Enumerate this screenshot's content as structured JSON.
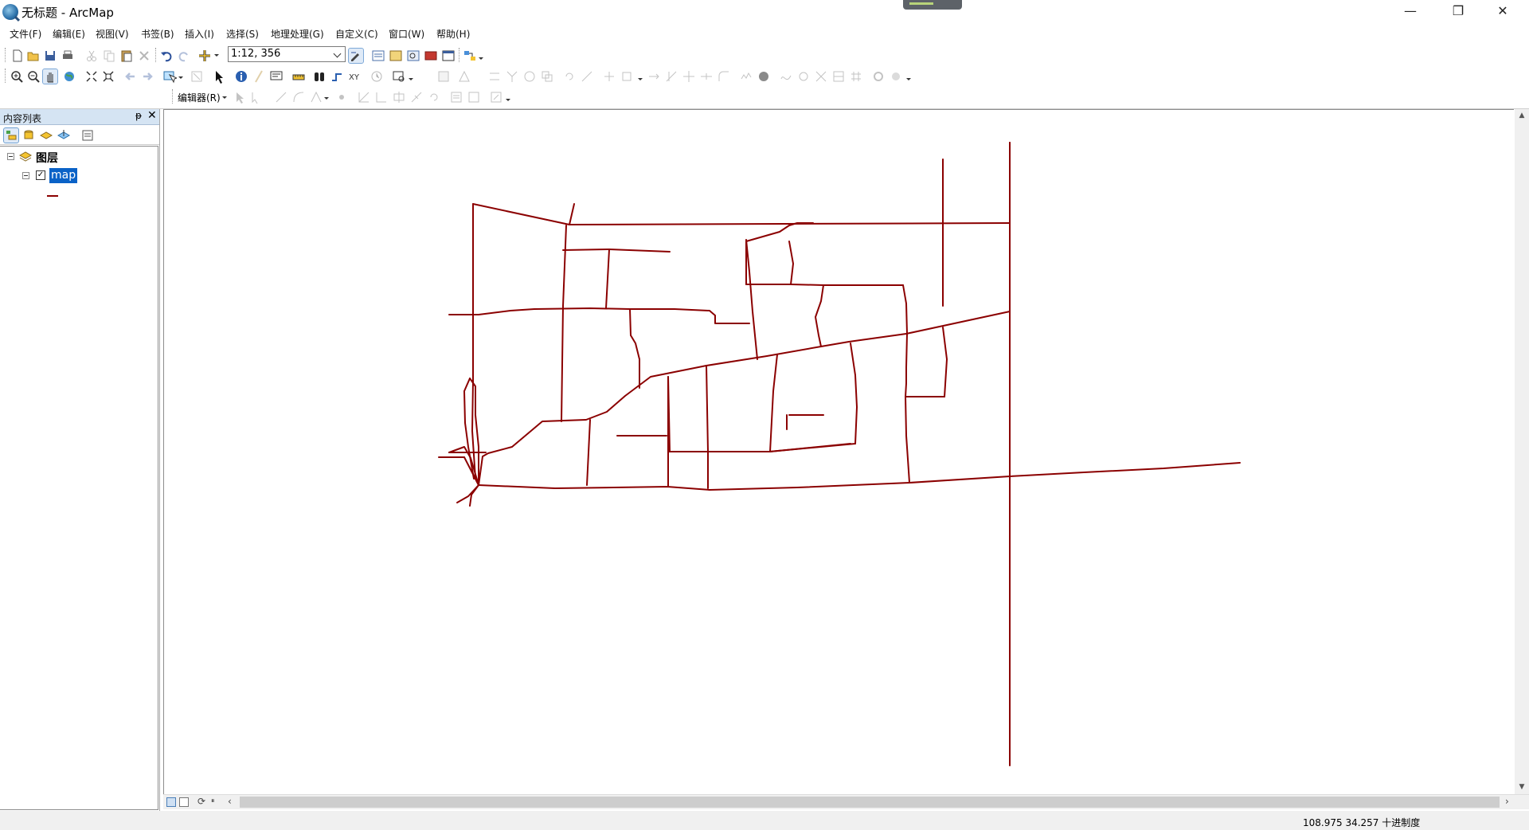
{
  "window": {
    "title": "无标题 - ArcMap",
    "minimize_glyph": "—",
    "maximize_glyph": "❐",
    "close_glyph": "✕"
  },
  "menu": [
    {
      "label": "文件(F)"
    },
    {
      "label": "编辑(E)"
    },
    {
      "label": "视图(V)"
    },
    {
      "label": "书签(B)"
    },
    {
      "label": "插入(I)"
    },
    {
      "label": "选择(S)"
    },
    {
      "label": "地理处理(G)"
    },
    {
      "label": "自定义(C)"
    },
    {
      "label": "窗口(W)"
    },
    {
      "label": "帮助(H)"
    }
  ],
  "standard_toolbar": {
    "scale": "1:12, 356",
    "icons": [
      "new-document-icon",
      "open-icon",
      "save-icon",
      "print-icon",
      "cut-icon",
      "copy-icon",
      "paste-icon",
      "delete-icon",
      "undo-icon",
      "redo-icon",
      "add-data-icon"
    ]
  },
  "tools_toolbar": {
    "icons": [
      "zoom-in-icon",
      "zoom-out-icon",
      "pan-icon",
      "full-extent-icon",
      "fixed-zoom-in-icon",
      "fixed-zoom-out-icon",
      "back-extent-icon",
      "forward-extent-icon",
      "select-features-icon",
      "clear-selection-icon",
      "select-elements-icon",
      "identify-icon",
      "hyperlink-icon",
      "html-popup-icon",
      "measure-icon",
      "find-icon",
      "find-route-icon",
      "go-to-xy-icon",
      "time-slider-icon",
      "create-viewer-icon"
    ]
  },
  "editor_toolbar": {
    "label": "编辑器(R)"
  },
  "toc": {
    "title": "内容列表",
    "pin_glyph": "ᵽ",
    "close_glyph": "✕",
    "root_layer": "图层",
    "layer_name": "map",
    "layer_checked": "✓",
    "symbol_color": "#8b0000"
  },
  "map": {
    "line_color": "#8b0000",
    "background": "#ffffff"
  },
  "scrollbars": {
    "up_glyph": "▲",
    "down_glyph": "▼",
    "left_glyph": "‹",
    "right_glyph": "›",
    "refresh_glyph": "⟳",
    "pause_glyph": "⏸"
  },
  "status": {
    "coordinates": "108.975  34.257 十进制度"
  }
}
